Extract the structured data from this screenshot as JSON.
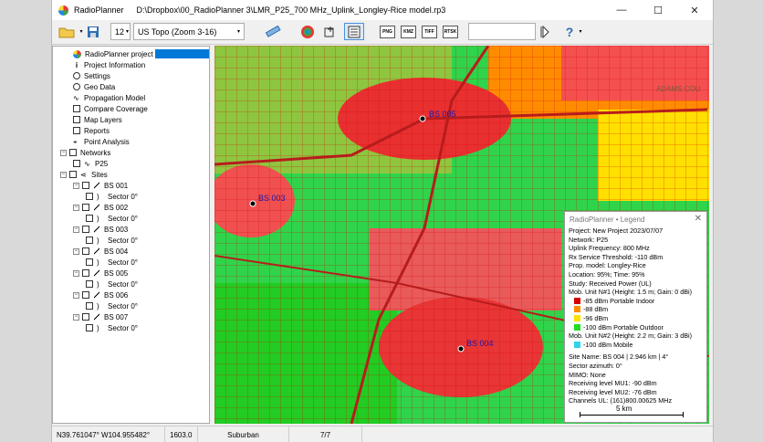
{
  "window": {
    "app_name": "RadioPlanner",
    "doc_path": "D:\\Dropbox\\00_RadioPlanner 3\\LMR_P25_700 MHz_Uplink_Longley-Rice model.rp3",
    "controls": {
      "minimize": "—",
      "maximize": "☐",
      "close": "✕"
    }
  },
  "toolbar": {
    "zoom_value": "12",
    "map_source": "US Topo (Zoom 3-16)",
    "formats": [
      "PNG",
      "KMZ",
      "TIFF",
      "RTSK"
    ],
    "search_value": "",
    "help": "?"
  },
  "tree": {
    "project": "RadioPlanner project",
    "items": [
      "Project Information",
      "Settings",
      "Geo Data",
      "Propagation Model",
      "Compare Coverage",
      "Map Layers",
      "Reports",
      "Point Analysis"
    ],
    "networks_label": "Networks",
    "network": "P25",
    "sites_label": "Sites",
    "sites": [
      "BS 001",
      "BS 002",
      "BS 003",
      "BS 004",
      "BS 005",
      "BS 006",
      "BS 007"
    ],
    "sector": "Sector 0°"
  },
  "map": {
    "bs_labels": [
      "BS 003",
      "BS 005",
      "BS 004"
    ],
    "watermark": "ADAMS COU"
  },
  "legend": {
    "title": "RadioPlanner • Legend",
    "close": "✕",
    "lines": [
      "Project: New Project 2023/07/07",
      "Network: P25",
      "Uplink Frequency: 800 MHz",
      "Rx Service Threshold: -110 dBm",
      "Prop. model: Longley-Rice",
      "Location: 95%; Time: 95%",
      "Study: Received Power (UL)",
      "Mob. Unit N#1 (Height: 1.5 m; Gain: 0 dBi)"
    ],
    "unit1_items": [
      {
        "label": "-85 dBm Portable Indoor",
        "color": "#d40000"
      },
      {
        "label": "-88 dBm",
        "color": "#ff8c00"
      },
      {
        "label": "-96 dBm",
        "color": "#ffe000"
      },
      {
        "label": "-100 dBm Portable Outdoor",
        "color": "#22dd22"
      }
    ],
    "unit2_line": "Mob. Unit N#2 (Height: 2.2 m; Gain: 3 dBi)",
    "unit2_items": [
      {
        "label": "-100 dBm Mobile",
        "color": "#2fd4e8"
      }
    ],
    "site_lines": [
      "Site Name: BS 004 | 2.946 km | 4°",
      "Sector azimuth: 0°",
      "MIMO: None",
      "Receiving level MU1: -90 dBm",
      "Receiving level MU2: -76 dBm",
      "Channels UL: (161)800.00625 MHz"
    ],
    "scale": "5 km"
  },
  "status": {
    "coords": "N39.761047°  W104.955482°",
    "elevation": "1603.0",
    "clutter": "Suburban",
    "progress": "7/7"
  }
}
